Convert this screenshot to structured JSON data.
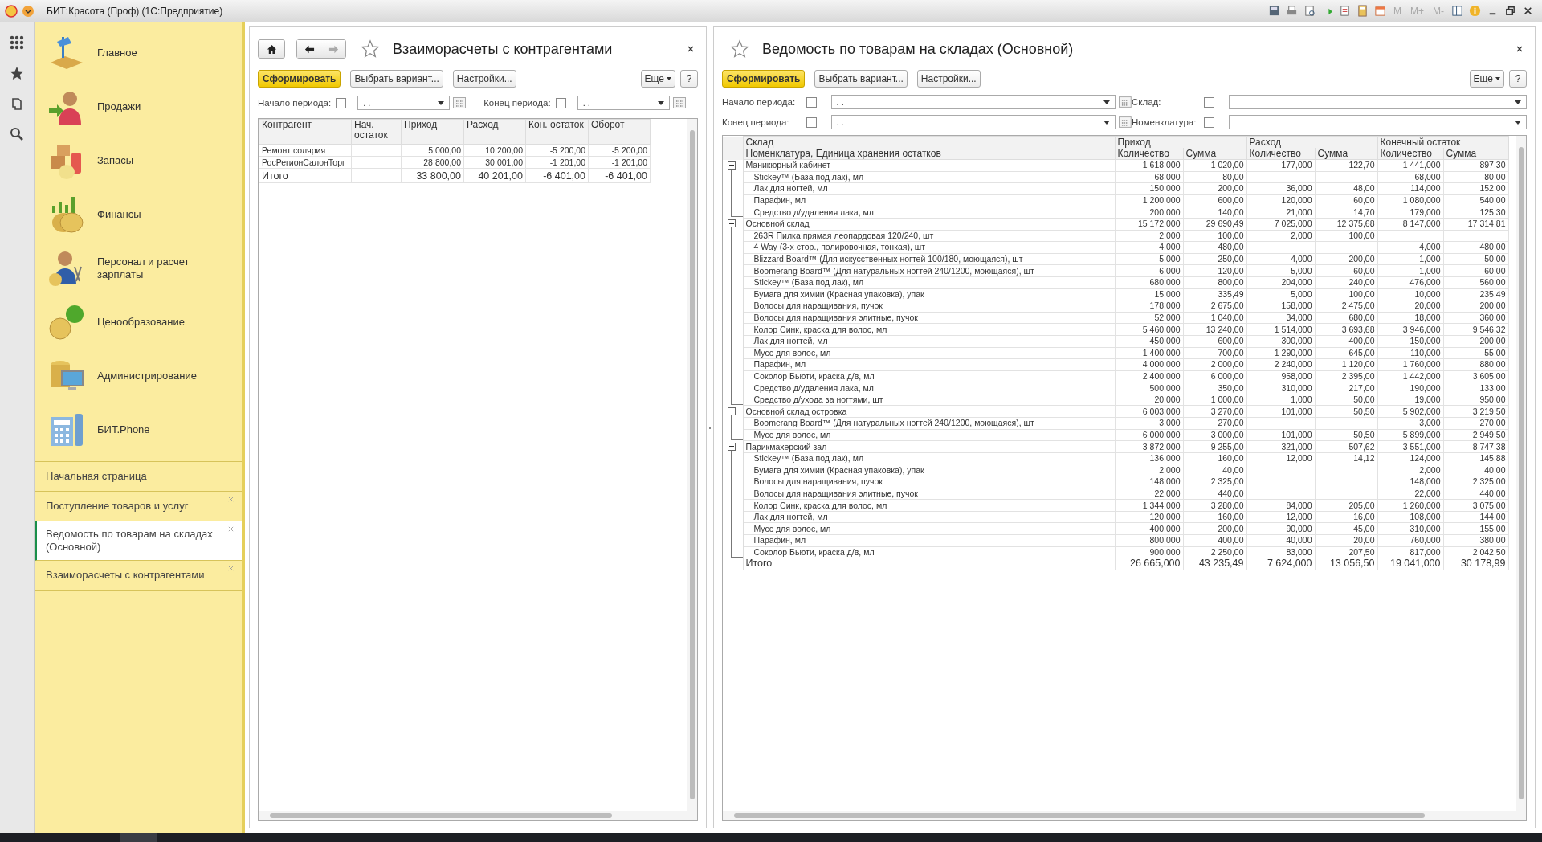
{
  "window": {
    "title": "БИТ:Красота (Проф)  (1С:Предприятие)",
    "memory_buttons": [
      "M",
      "M+",
      "M-"
    ]
  },
  "sections": [
    {
      "label": "Главное"
    },
    {
      "label": "Продажи"
    },
    {
      "label": "Запасы"
    },
    {
      "label": "Финансы"
    },
    {
      "label": "Персонал и расчет зарплаты"
    },
    {
      "label": "Ценообразование"
    },
    {
      "label": "Администрирование"
    },
    {
      "label": "БИТ.Phone"
    }
  ],
  "open_windows": [
    {
      "label": "Начальная страница",
      "selected": false,
      "closable": false
    },
    {
      "label": "Поступление товаров и услуг",
      "selected": false,
      "closable": true
    },
    {
      "label": "Ведомость по товарам на складах (Основной)",
      "selected": true,
      "closable": true
    },
    {
      "label": "Взаиморасчеты с контрагентами",
      "selected": false,
      "closable": true
    }
  ],
  "left_report": {
    "title": "Взаиморасчеты с контрагентами",
    "buttons": {
      "generate": "Сформировать",
      "variant": "Выбрать вариант...",
      "settings": "Настройки...",
      "more": "Еще",
      "help": "?"
    },
    "filters": [
      {
        "label": "Начало периода:",
        "checked": false,
        "value": ". ."
      },
      {
        "label": "Конец периода:",
        "checked": false,
        "value": ". ."
      }
    ],
    "columns": [
      "Контрагент",
      "Нач. остаток",
      "Приход",
      "Расход",
      "Кон. остаток",
      "Оборот"
    ],
    "rows": [
      {
        "name": "Ремонт солярия",
        "income": "5 000,00",
        "expense": "10 200,00",
        "closing": "-5 200,00",
        "turnover": "-5 200,00"
      },
      {
        "name": "РосРегионСалонТорг",
        "income": "28 800,00",
        "expense": "30 001,00",
        "closing": "-1 201,00",
        "turnover": "-1 201,00"
      }
    ],
    "total": {
      "name": "Итого",
      "income": "33 800,00",
      "expense": "40 201,00",
      "closing": "-6 401,00",
      "turnover": "-6 401,00"
    }
  },
  "right_report": {
    "title": "Ведомость по товарам на складах (Основной)",
    "buttons": {
      "generate": "Сформировать",
      "variant": "Выбрать вариант...",
      "settings": "Настройки...",
      "more": "Еще",
      "help": "?"
    },
    "filters": [
      {
        "label": "Начало периода:",
        "checked": false,
        "value": ". .",
        "kind": "date"
      },
      {
        "label": "Склад:",
        "checked": false,
        "kind": "select"
      },
      {
        "label": "Конец периода:",
        "checked": false,
        "value": ". .",
        "kind": "date"
      },
      {
        "label": "Номенклатура:",
        "checked": false,
        "kind": "select"
      }
    ],
    "header_top": [
      "Склад",
      "Приход",
      "Расход",
      "Конечный остаток"
    ],
    "header_sub": [
      "Номенклатура, Единица хранения остатков",
      "Количество",
      "Сумма",
      "Количество",
      "Сумма",
      "Количество",
      "Сумма"
    ],
    "groups": [
      {
        "name": "Маникюрный кабинет",
        "expanded": true,
        "in_qty": "1 618,000",
        "in_sum": "1 020,00",
        "out_qty": "177,000",
        "out_sum": "122,70",
        "end_qty": "1 441,000",
        "end_sum": "897,30",
        "children": [
          {
            "name": "Stickey™ (База под лак), мл",
            "in_qty": "68,000",
            "in_sum": "80,00",
            "end_qty": "68,000",
            "end_sum": "80,00"
          },
          {
            "name": "Лак для ногтей, мл",
            "in_qty": "150,000",
            "in_sum": "200,00",
            "out_qty": "36,000",
            "out_sum": "48,00",
            "end_qty": "114,000",
            "end_sum": "152,00"
          },
          {
            "name": "Парафин, мл",
            "in_qty": "1 200,000",
            "in_sum": "600,00",
            "out_qty": "120,000",
            "out_sum": "60,00",
            "end_qty": "1 080,000",
            "end_sum": "540,00"
          },
          {
            "name": "Средство д/удаления лака, мл",
            "in_qty": "200,000",
            "in_sum": "140,00",
            "out_qty": "21,000",
            "out_sum": "14,70",
            "end_qty": "179,000",
            "end_sum": "125,30"
          }
        ]
      },
      {
        "name": "Основной склад",
        "expanded": true,
        "in_qty": "15 172,000",
        "in_sum": "29 690,49",
        "out_qty": "7 025,000",
        "out_sum": "12 375,68",
        "end_qty": "8 147,000",
        "end_sum": "17 314,81",
        "children": [
          {
            "name": "263R Пилка прямая леопардовая 120/240, шт",
            "in_qty": "2,000",
            "in_sum": "100,00",
            "out_qty": "2,000",
            "out_sum": "100,00"
          },
          {
            "name": "4 Way (3-х стор., полировочная, тонкая), шт",
            "in_qty": "4,000",
            "in_sum": "480,00",
            "end_qty": "4,000",
            "end_sum": "480,00"
          },
          {
            "name": "Blizzard Board™ (Для искусственных ногтей 100/180, моющаяся), шт",
            "in_qty": "5,000",
            "in_sum": "250,00",
            "out_qty": "4,000",
            "out_sum": "200,00",
            "end_qty": "1,000",
            "end_sum": "50,00"
          },
          {
            "name": "Boomerang Board™ (Для натуральных ногтей 240/1200, моющаяся), шт",
            "in_qty": "6,000",
            "in_sum": "120,00",
            "out_qty": "5,000",
            "out_sum": "60,00",
            "end_qty": "1,000",
            "end_sum": "60,00"
          },
          {
            "name": "Stickey™ (База под лак), мл",
            "in_qty": "680,000",
            "in_sum": "800,00",
            "out_qty": "204,000",
            "out_sum": "240,00",
            "end_qty": "476,000",
            "end_sum": "560,00"
          },
          {
            "name": "Бумага для химии (Красная упаковка), упак",
            "in_qty": "15,000",
            "in_sum": "335,49",
            "out_qty": "5,000",
            "out_sum": "100,00",
            "end_qty": "10,000",
            "end_sum": "235,49"
          },
          {
            "name": "Волосы для наращивания, пучок",
            "in_qty": "178,000",
            "in_sum": "2 675,00",
            "out_qty": "158,000",
            "out_sum": "2 475,00",
            "end_qty": "20,000",
            "end_sum": "200,00"
          },
          {
            "name": "Волосы для наращивания элитные, пучок",
            "in_qty": "52,000",
            "in_sum": "1 040,00",
            "out_qty": "34,000",
            "out_sum": "680,00",
            "end_qty": "18,000",
            "end_sum": "360,00"
          },
          {
            "name": "Колор Синк, краска для волос, мл",
            "in_qty": "5 460,000",
            "in_sum": "13 240,00",
            "out_qty": "1 514,000",
            "out_sum": "3 693,68",
            "end_qty": "3 946,000",
            "end_sum": "9 546,32"
          },
          {
            "name": "Лак для ногтей, мл",
            "in_qty": "450,000",
            "in_sum": "600,00",
            "out_qty": "300,000",
            "out_sum": "400,00",
            "end_qty": "150,000",
            "end_sum": "200,00"
          },
          {
            "name": "Мусс для волос, мл",
            "in_qty": "1 400,000",
            "in_sum": "700,00",
            "out_qty": "1 290,000",
            "out_sum": "645,00",
            "end_qty": "110,000",
            "end_sum": "55,00"
          },
          {
            "name": "Парафин, мл",
            "in_qty": "4 000,000",
            "in_sum": "2 000,00",
            "out_qty": "2 240,000",
            "out_sum": "1 120,00",
            "end_qty": "1 760,000",
            "end_sum": "880,00"
          },
          {
            "name": "Соколор Бьюти, краска д/в, мл",
            "in_qty": "2 400,000",
            "in_sum": "6 000,00",
            "out_qty": "958,000",
            "out_sum": "2 395,00",
            "end_qty": "1 442,000",
            "end_sum": "3 605,00"
          },
          {
            "name": "Средство д/удаления лака, мл",
            "in_qty": "500,000",
            "in_sum": "350,00",
            "out_qty": "310,000",
            "out_sum": "217,00",
            "end_qty": "190,000",
            "end_sum": "133,00"
          },
          {
            "name": "Средство д/ухода за ногтями, шт",
            "in_qty": "20,000",
            "in_sum": "1 000,00",
            "out_qty": "1,000",
            "out_sum": "50,00",
            "end_qty": "19,000",
            "end_sum": "950,00"
          }
        ]
      },
      {
        "name": "Основной склад островка",
        "expanded": true,
        "in_qty": "6 003,000",
        "in_sum": "3 270,00",
        "out_qty": "101,000",
        "out_sum": "50,50",
        "end_qty": "5 902,000",
        "end_sum": "3 219,50",
        "children": [
          {
            "name": "Boomerang Board™ (Для натуральных ногтей 240/1200, моющаяся), шт",
            "in_qty": "3,000",
            "in_sum": "270,00",
            "end_qty": "3,000",
            "end_sum": "270,00"
          },
          {
            "name": "Мусс для волос, мл",
            "in_qty": "6 000,000",
            "in_sum": "3 000,00",
            "out_qty": "101,000",
            "out_sum": "50,50",
            "end_qty": "5 899,000",
            "end_sum": "2 949,50"
          }
        ]
      },
      {
        "name": "Парикмахерский зал",
        "expanded": true,
        "in_qty": "3 872,000",
        "in_sum": "9 255,00",
        "out_qty": "321,000",
        "out_sum": "507,62",
        "end_qty": "3 551,000",
        "end_sum": "8 747,38",
        "children": [
          {
            "name": "Stickey™ (База под лак), мл",
            "in_qty": "136,000",
            "in_sum": "160,00",
            "out_qty": "12,000",
            "out_sum": "14,12",
            "end_qty": "124,000",
            "end_sum": "145,88"
          },
          {
            "name": "Бумага для химии (Красная упаковка), упак",
            "in_qty": "2,000",
            "in_sum": "40,00",
            "end_qty": "2,000",
            "end_sum": "40,00"
          },
          {
            "name": "Волосы для наращивания, пучок",
            "in_qty": "148,000",
            "in_sum": "2 325,00",
            "end_qty": "148,000",
            "end_sum": "2 325,00"
          },
          {
            "name": "Волосы для наращивания элитные, пучок",
            "in_qty": "22,000",
            "in_sum": "440,00",
            "end_qty": "22,000",
            "end_sum": "440,00"
          },
          {
            "name": "Колор Синк, краска для волос, мл",
            "in_qty": "1 344,000",
            "in_sum": "3 280,00",
            "out_qty": "84,000",
            "out_sum": "205,00",
            "end_qty": "1 260,000",
            "end_sum": "3 075,00"
          },
          {
            "name": "Лак для ногтей, мл",
            "in_qty": "120,000",
            "in_sum": "160,00",
            "out_qty": "12,000",
            "out_sum": "16,00",
            "end_qty": "108,000",
            "end_sum": "144,00"
          },
          {
            "name": "Мусс для волос, мл",
            "in_qty": "400,000",
            "in_sum": "200,00",
            "out_qty": "90,000",
            "out_sum": "45,00",
            "end_qty": "310,000",
            "end_sum": "155,00"
          },
          {
            "name": "Парафин, мл",
            "in_qty": "800,000",
            "in_sum": "400,00",
            "out_qty": "40,000",
            "out_sum": "20,00",
            "end_qty": "760,000",
            "end_sum": "380,00"
          },
          {
            "name": "Соколор Бьюти, краска д/в, мл",
            "in_qty": "900,000",
            "in_sum": "2 250,00",
            "out_qty": "83,000",
            "out_sum": "207,50",
            "end_qty": "817,000",
            "end_sum": "2 042,50"
          }
        ]
      }
    ],
    "total": {
      "name": "Итого",
      "in_qty": "26 665,000",
      "in_sum": "43 235,49",
      "out_qty": "7 624,000",
      "out_sum": "13 056,50",
      "end_qty": "19 041,000",
      "end_sum": "30 178,99"
    }
  }
}
